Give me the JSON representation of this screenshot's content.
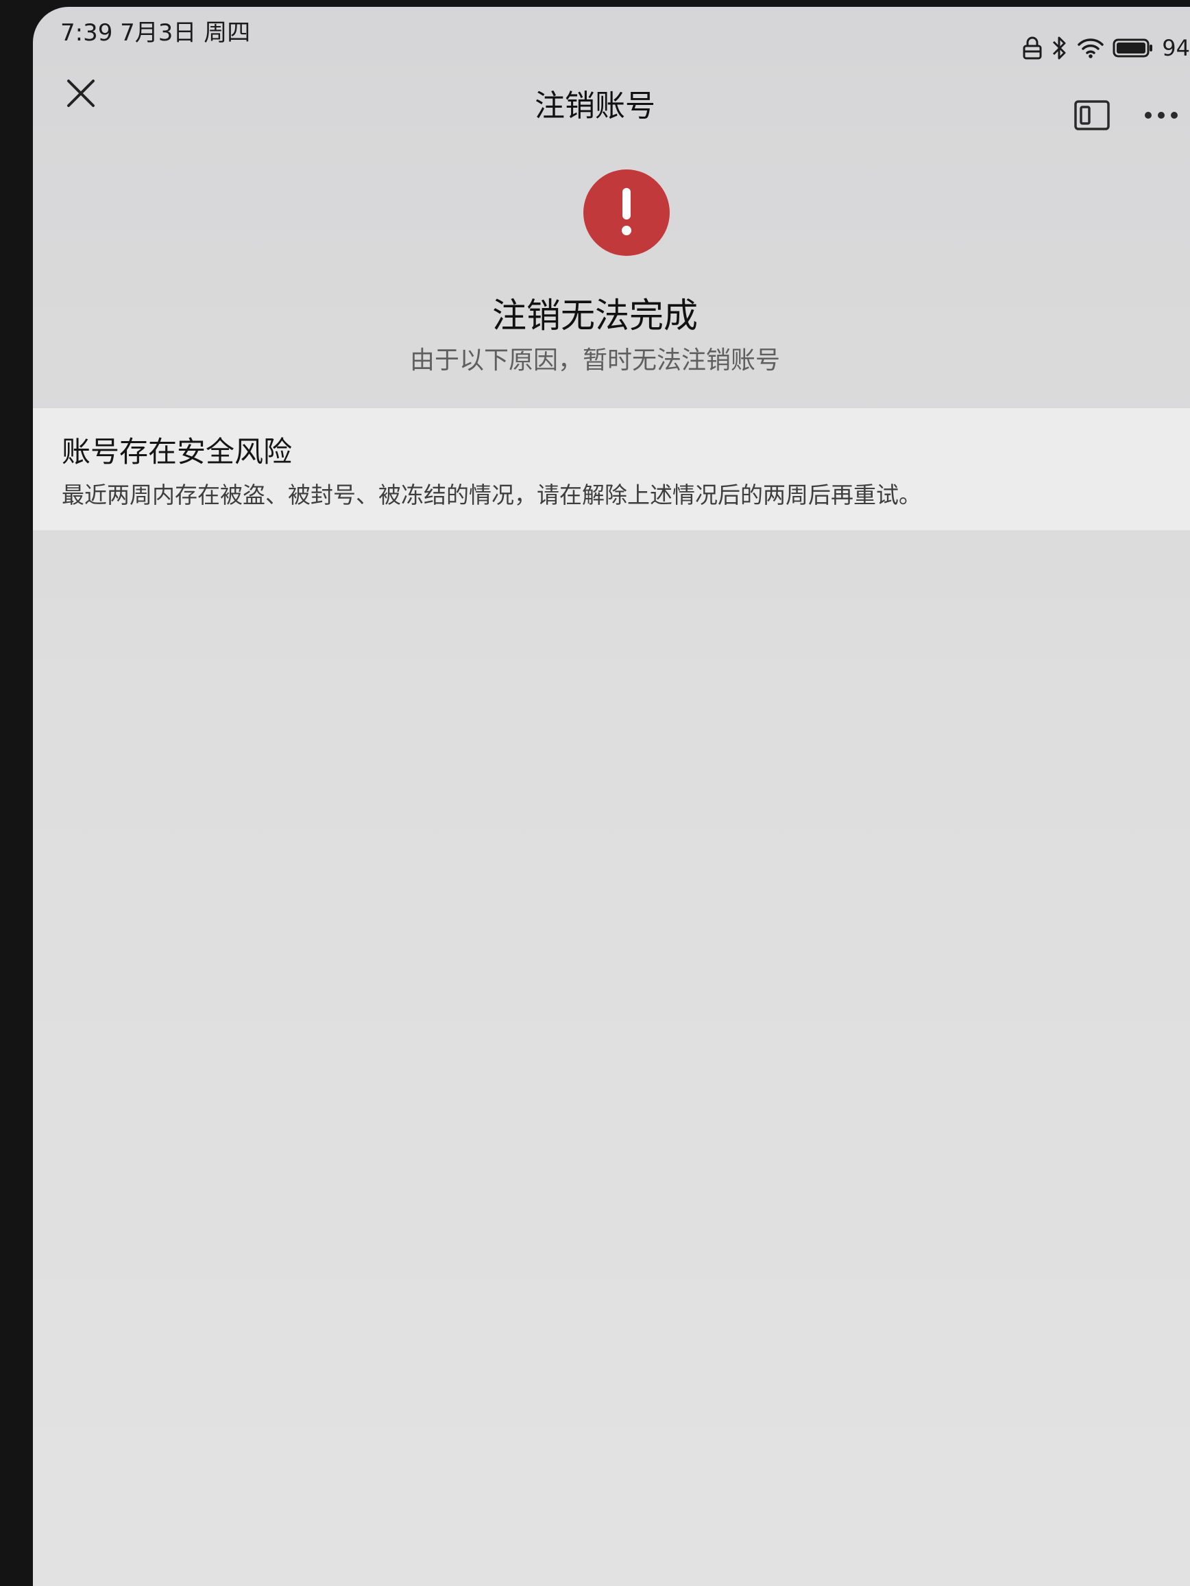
{
  "status_bar": {
    "time": "7:39  7月3日 周四",
    "battery": "94"
  },
  "nav": {
    "title": "注销账号"
  },
  "result": {
    "title": "注销无法完成",
    "subtitle": "由于以下原因，暂时无法注销账号"
  },
  "reason": {
    "title": "账号存在安全风险",
    "description": "最近两周内存在被盗、被封号、被冻结的情况，请在解除上述情况后的两周后再重试。"
  },
  "colors": {
    "alert": "#c2393b",
    "card": "#ececec",
    "background": "#dcdcdc"
  }
}
